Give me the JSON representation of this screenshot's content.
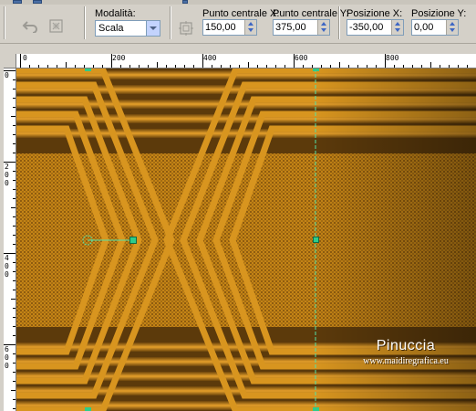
{
  "toolbar": {
    "mode": {
      "label": "Modalità:",
      "value": "Scala"
    },
    "center_x": {
      "label": "Punto centrale X:",
      "value": "150,00"
    },
    "center_y": {
      "label": "Punto centrale Y:",
      "value": "375,00"
    },
    "position_x": {
      "label": "Posizione X:",
      "value": "-350,00"
    },
    "position_y": {
      "label": "Posizione Y:",
      "value": "0,00"
    },
    "icons": [
      "undo-arrow-icon",
      "reset-pick-icon",
      "anchor-position-icon"
    ]
  },
  "rulers": {
    "horizontal_labels": [
      "0",
      "200",
      "400",
      "600",
      "800"
    ],
    "vertical_labels": [
      "0",
      "200",
      "400",
      "600"
    ]
  },
  "watermark": {
    "name": "Pinuccia",
    "url": "www.maidiregrafica.eu"
  },
  "colors": {
    "gold": "#d3901f",
    "dark_brown": "#5c3a0b",
    "handle": "#2ecc8a"
  }
}
